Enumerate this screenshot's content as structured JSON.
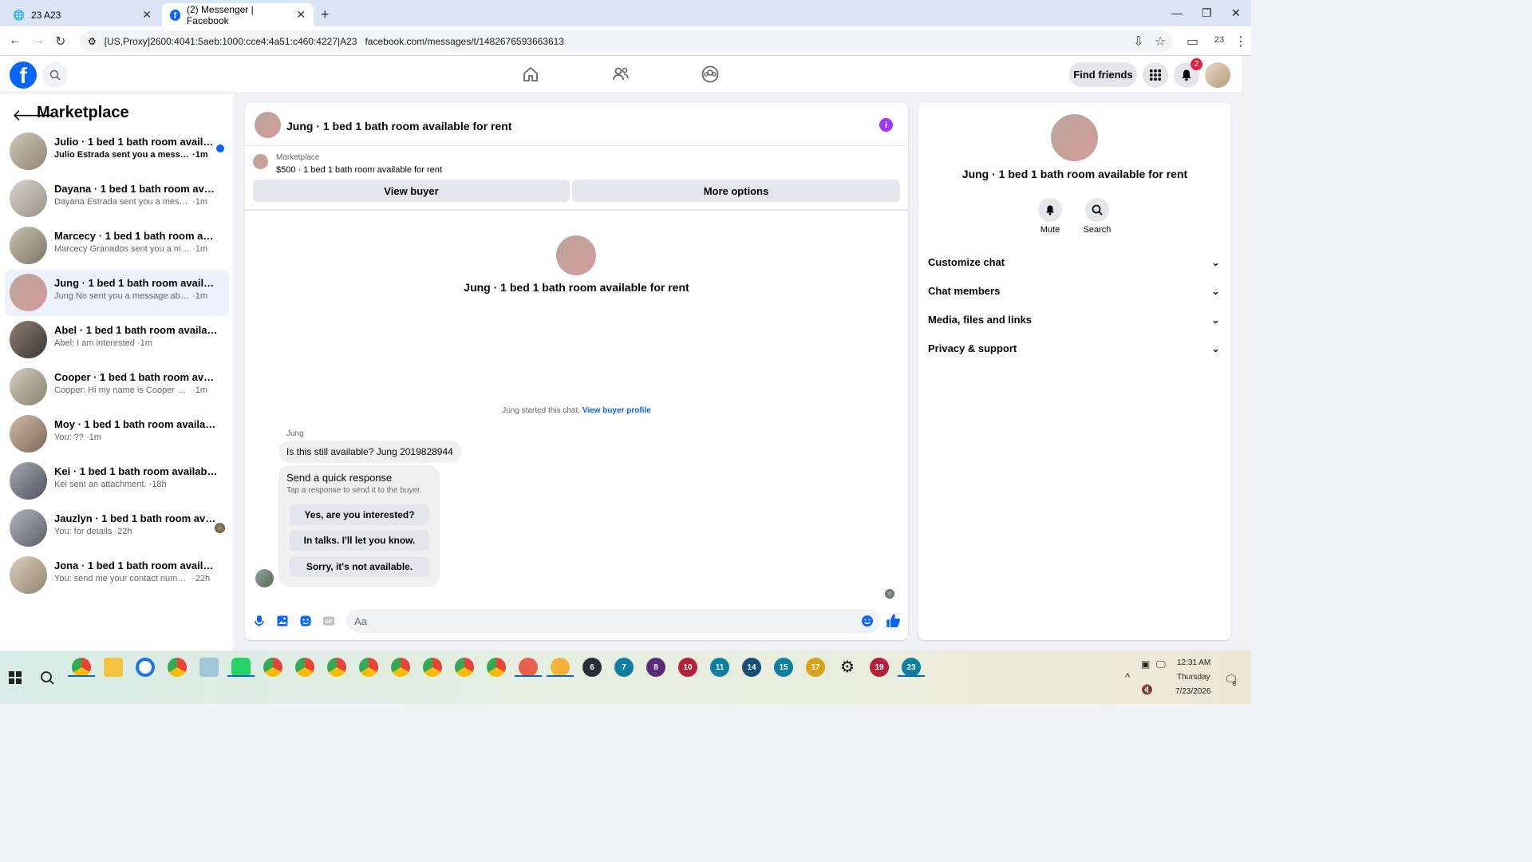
{
  "browser": {
    "tabs": [
      {
        "title": "23 A23"
      },
      {
        "title": "(2) Messenger | Facebook"
      }
    ],
    "proxy_label": "[US,Proxy]2600:4041:5aeb:1000:cce4:4a51:c460:4227|A23",
    "url": "facebook.com/messages/t/1482676593663613",
    "profile_count": "23"
  },
  "header": {
    "find_friends": "Find friends",
    "notification_count": "2"
  },
  "sidebar": {
    "title": "Marketplace",
    "conversations": [
      {
        "title": "Julio · 1 bed 1 bath room availabl...",
        "snippet": "Julio Estrada sent you a message ...",
        "time": "1m",
        "unread": true
      },
      {
        "title": "Dayana · 1 bed 1 bath room availa...",
        "snippet": "Dayana Estrada sent you a message a...",
        "time": "1m"
      },
      {
        "title": "Marcecy · 1 bed 1 bath room availa...",
        "snippet": "Marcecy Granados sent you a messa...",
        "time": "1m"
      },
      {
        "title": "Jung · 1 bed 1 bath room available ...",
        "snippet": "Jung No sent you a message about y...",
        "time": "1m",
        "active": true
      },
      {
        "title": "Abel · 1 bed 1 bath room available ...",
        "snippet": "Abel: I am interested",
        "time": "1m"
      },
      {
        "title": "Cooper · 1 bed 1 bath room availab...",
        "snippet": "Cooper: Hi my name is Cooper partn...",
        "time": "1m"
      },
      {
        "title": "Moy · 1 bed 1 bath room available ...",
        "snippet": "You: ??",
        "time": "1m"
      },
      {
        "title": "Kei · 1 bed 1 bath room available f...",
        "snippet": "Kei sent an attachment.",
        "time": "18h"
      },
      {
        "title": "Jauzlyn · 1 bed 1 bath room avail...",
        "snippet": "You: for details",
        "time": "22h"
      },
      {
        "title": "Jona · 1 bed 1 bath room available ...",
        "snippet": "You: send me your contact number i ...",
        "time": "22h"
      }
    ]
  },
  "chat": {
    "title": "Jung · 1 bed 1 bath room available for rent",
    "listing_source": "Marketplace",
    "listing_text": "$500 · 1 bed 1 bath room available for rent",
    "view_buyer": "View buyer",
    "more_options": "More options",
    "center_title": "Jung · 1 bed 1 bath room available for rent",
    "started_text": "Jung started this chat.",
    "view_buyer_profile": "View buyer profile",
    "sender": "Jung",
    "message": "Is this still available? Jung 2019828944",
    "quick_title": "Send a quick response",
    "quick_sub": "Tap a response to send it to the buyer.",
    "quick_replies": [
      "Yes, are you interested?",
      "In talks. I'll let you know.",
      "Sorry, it's not available."
    ],
    "composer_placeholder": "Aa"
  },
  "info_panel": {
    "title": "Jung · 1 bed 1 bath room available for rent",
    "mute": "Mute",
    "search": "Search",
    "sections": [
      "Customize chat",
      "Chat members",
      "Media, files and links",
      "Privacy & support"
    ]
  },
  "taskbar": {
    "badges": [
      "6",
      "7",
      "8",
      "10",
      "11",
      "14",
      "15",
      "17",
      "19",
      "23"
    ],
    "time": "12:31 AM",
    "day": "Thursday",
    "date": "7/23/2026",
    "notif_count": "8"
  }
}
